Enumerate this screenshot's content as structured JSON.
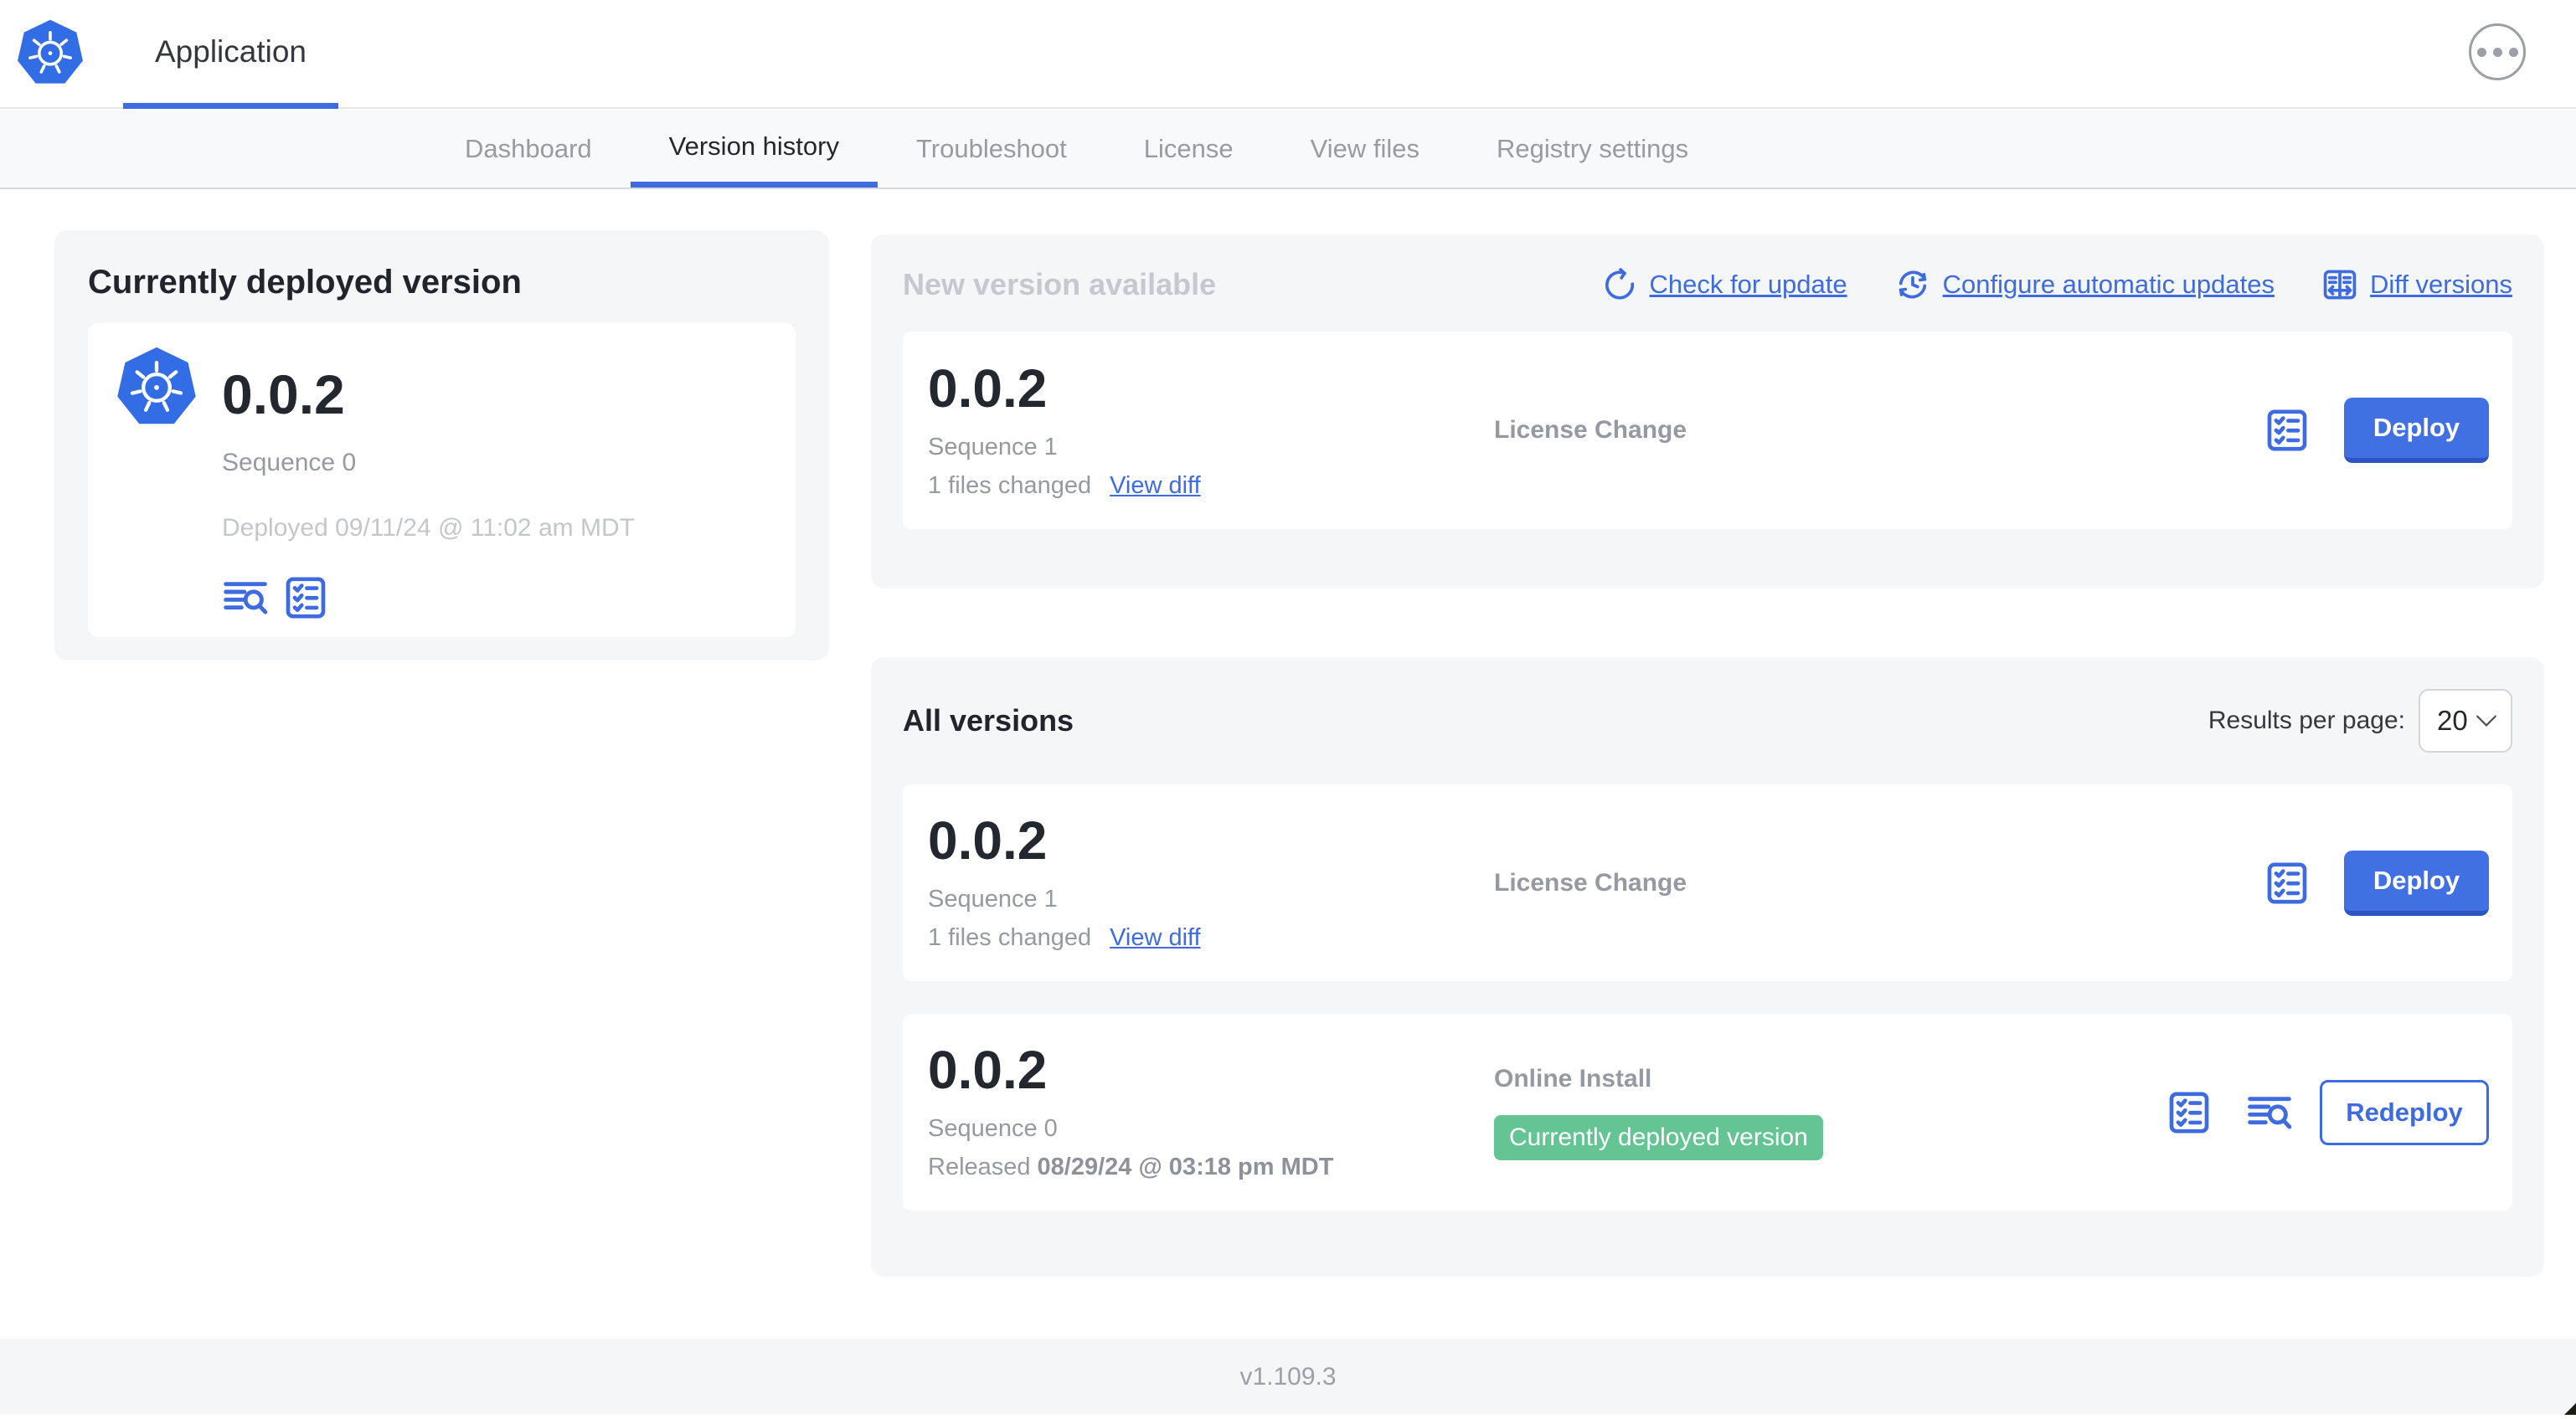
{
  "header": {
    "app_title": "Application"
  },
  "nav": {
    "tabs": [
      {
        "label": "Dashboard"
      },
      {
        "label": "Version history"
      },
      {
        "label": "Troubleshoot"
      },
      {
        "label": "License"
      },
      {
        "label": "View files"
      },
      {
        "label": "Registry settings"
      }
    ],
    "active_tab": "Version history"
  },
  "currently_deployed": {
    "heading": "Currently deployed version",
    "version": "0.0.2",
    "sequence": "Sequence 0",
    "deployed_timestamp": "Deployed 09/11/24 @ 11:02 am MDT"
  },
  "new_version": {
    "heading": "New version available",
    "check_for_update": "Check for update",
    "configure_automatic_updates": "Configure automatic updates",
    "diff_versions": "Diff versions",
    "row": {
      "version": "0.0.2",
      "sequence": "Sequence 1",
      "files_changed": "1 files changed",
      "view_diff": "View diff",
      "source": "License Change",
      "action": "Deploy"
    }
  },
  "all_versions": {
    "heading": "All versions",
    "results_per_page_label": "Results per page:",
    "results_per_page_value": "20",
    "rows": [
      {
        "version": "0.0.2",
        "sequence": "Sequence 1",
        "files_changed": "1 files changed",
        "view_diff": "View diff",
        "source": "License Change",
        "action": "Deploy"
      },
      {
        "version": "0.0.2",
        "sequence": "Sequence 0",
        "released_prefix": "Released",
        "released_date": "08/29/24 @ 03:18 pm MDT",
        "source": "Online Install",
        "badge": "Currently deployed version",
        "action": "Redeploy"
      }
    ]
  },
  "footer": {
    "app_version": "v1.109.3"
  },
  "icons": {
    "logo": "kubernetes-wheel-icon",
    "overflow": "ellipsis-menu-icon",
    "check_update": "refresh-icon",
    "auto_update": "clock-sync-icon",
    "diff": "diff-columns-icon",
    "preflight": "checklist-icon",
    "logs": "log-search-icon",
    "select": "chevron-down-icon"
  },
  "colors": {
    "accent_blue": "#3e6be0",
    "button_blue": "#4170e2",
    "button_blue_edge": "#2d55bf",
    "kubernetes_blue": "#326de6",
    "badge_green": "#65c494",
    "card_gray": "#f5f6f8",
    "nav_gray": "#f8f9fa",
    "muted_text": "#9599a0",
    "faint_text": "#c3c7cd",
    "heading_text": "#20242b"
  }
}
